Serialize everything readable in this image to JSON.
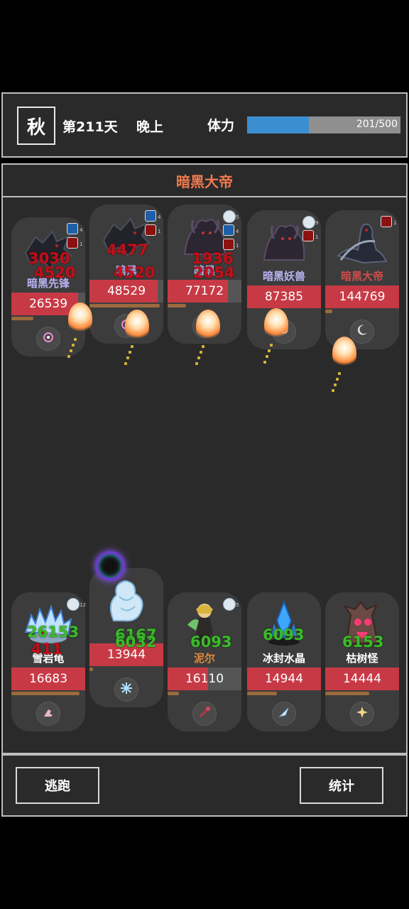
{
  "header": {
    "season": "秋",
    "day": "第211天",
    "time_of_day": "晚上",
    "stamina_label": "体力",
    "stamina_text": "201/500",
    "stamina_fraction": 0.402
  },
  "battle": {
    "title": "暗黑大帝",
    "enemies": [
      {
        "name": "暗黑先锋",
        "hp": "26539",
        "hp_fraction": 0.9,
        "energy_fraction": 0.3,
        "name_color": "#b9b2f2",
        "badges": [
          "blue",
          "red"
        ],
        "badge_counts": [
          "4",
          "1"
        ],
        "sprite": "dark-wolf",
        "skill_icon": "crosshair-icon"
      },
      {
        "name": "暗黑",
        "hp": "48529",
        "hp_fraction": 0.92,
        "energy_fraction": 0.95,
        "name_color": "#b9b2f2",
        "badges": [
          "blue",
          "red"
        ],
        "badge_counts": [
          "4",
          "1"
        ],
        "sprite": "dark-wolf",
        "skill_icon": "crosshair-icon"
      },
      {
        "name": "暗黑",
        "hp": "77172",
        "hp_fraction": 0.82,
        "energy_fraction": 0.25,
        "name_color": "#b9b2f2",
        "badges": [
          "gem",
          "blue",
          "red"
        ],
        "badge_counts": [
          "5",
          "4",
          "1"
        ],
        "sprite": "dark-beast",
        "skill_icon": "swirl-icon"
      },
      {
        "name": "暗黑妖兽",
        "hp": "87385",
        "hp_fraction": 1.0,
        "energy_fraction": 0.0,
        "name_color": "#b9b2f2",
        "badges": [
          "gem",
          "red"
        ],
        "badge_counts": [
          "9",
          "1"
        ],
        "sprite": "dark-beast",
        "skill_icon": "swirl-icon"
      },
      {
        "name": "暗黑大帝",
        "hp": "144769",
        "hp_fraction": 1.0,
        "energy_fraction": 0.1,
        "name_color": "#d14b4b",
        "badges": [
          "red"
        ],
        "badge_counts": [
          "1"
        ],
        "sprite": "dark-emperor",
        "skill_icon": "moon-icon"
      }
    ],
    "allies": [
      {
        "name": "雪岩龟",
        "hp": "16683",
        "hp_fraction": 1.0,
        "energy_fraction": 0.92,
        "name_color": "#ffffff",
        "badges": [
          "gem"
        ],
        "badge_counts": [
          "12"
        ],
        "sprite": "ice-turtle",
        "skill_icon": "boot-icon"
      },
      {
        "name": "",
        "hp": "13944",
        "hp_fraction": 1.0,
        "energy_fraction": 0.05,
        "name_color": "#ffffff",
        "badges": [],
        "badge_counts": [],
        "sprite": "ice-dragon",
        "skill_icon": "snowflake-icon"
      },
      {
        "name": "泥尔",
        "hp": "16110",
        "hp_fraction": 0.55,
        "energy_fraction": 0.15,
        "name_color": "#e08a3a",
        "badges": [
          "gem"
        ],
        "badge_counts": [
          "5"
        ],
        "sprite": "elf-girl",
        "skill_icon": "staff-icon"
      },
      {
        "name": "冰封水晶",
        "hp": "14944",
        "hp_fraction": 1.0,
        "energy_fraction": 0.4,
        "name_color": "#ffffff",
        "badges": [],
        "badge_counts": [],
        "sprite": "ice-crystal",
        "skill_icon": "ice-shard-icon"
      },
      {
        "name": "枯树怪",
        "hp": "14444",
        "hp_fraction": 1.0,
        "energy_fraction": 0.6,
        "name_color": "#ffffff",
        "badges": [],
        "badge_counts": [],
        "sprite": "dead-tree",
        "skill_icon": "burst-icon"
      }
    ],
    "damage_numbers": [
      "3030",
      "4477",
      "4520",
      "4520",
      "1936",
      "2054",
      "411"
    ],
    "heal_numbers": [
      "26153",
      "6167",
      "6032",
      "6093",
      "6093",
      "6153"
    ]
  },
  "footer": {
    "flee_label": "逃跑",
    "stats_label": "统计"
  }
}
